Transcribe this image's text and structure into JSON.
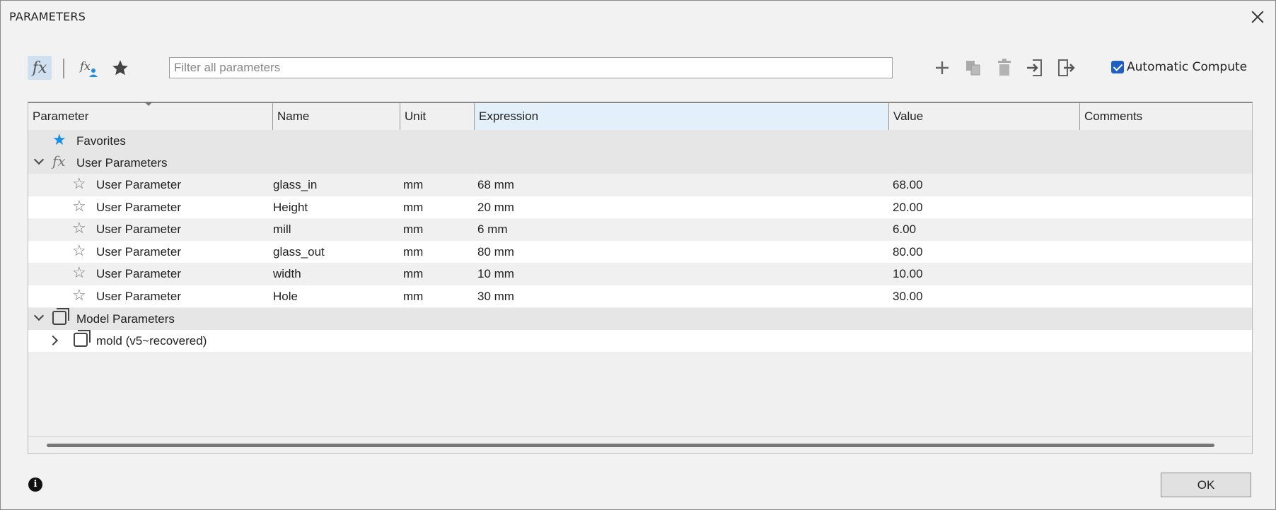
{
  "window": {
    "title": "PARAMETERS"
  },
  "toolbar": {
    "fx_glyph": "fx",
    "filter_placeholder": "Filter all parameters",
    "auto_compute_label": "Automatic Compute",
    "auto_compute_checked": true,
    "icons": [
      "fx-all-icon",
      "fx-user-icon",
      "favorites-star-icon",
      "add-icon",
      "copy-icon",
      "delete-icon",
      "import-icon",
      "export-icon"
    ]
  },
  "table": {
    "columns": [
      "Parameter",
      "Name",
      "Unit",
      "Expression",
      "Value",
      "Comments"
    ],
    "groups": {
      "favorites": "Favorites",
      "user": "User Parameters",
      "model": "Model Parameters",
      "model_child": "mold (v5~recovered)"
    },
    "rows": [
      {
        "parameter": "User Parameter",
        "name": "glass_in",
        "unit": "mm",
        "expression": "68 mm",
        "value": "68.00",
        "comments": ""
      },
      {
        "parameter": "User Parameter",
        "name": "Height",
        "unit": "mm",
        "expression": "20 mm",
        "value": "20.00",
        "comments": ""
      },
      {
        "parameter": "User Parameter",
        "name": "mill",
        "unit": "mm",
        "expression": "6 mm",
        "value": "6.00",
        "comments": ""
      },
      {
        "parameter": "User Parameter",
        "name": "glass_out",
        "unit": "mm",
        "expression": "80 mm",
        "value": "80.00",
        "comments": ""
      },
      {
        "parameter": "User Parameter",
        "name": "width",
        "unit": "mm",
        "expression": "10 mm",
        "value": "10.00",
        "comments": ""
      },
      {
        "parameter": "User Parameter",
        "name": "Hole",
        "unit": "mm",
        "expression": "30 mm",
        "value": "30.00",
        "comments": ""
      }
    ]
  },
  "footer": {
    "info_glyph": "i",
    "ok_label": "OK"
  },
  "colors": {
    "accent": "#1f5fbf",
    "favorite_star": "#1a8ee6",
    "selected_header": "#e3f0fa"
  }
}
